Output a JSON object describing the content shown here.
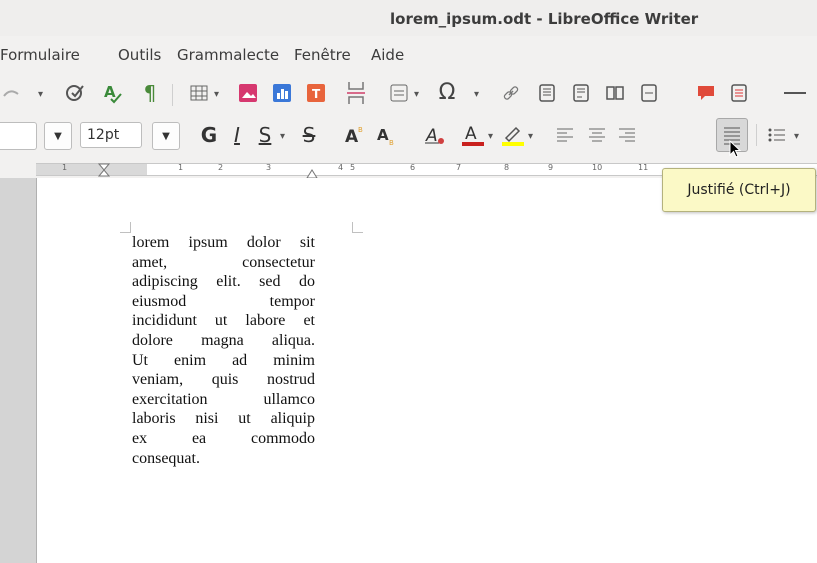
{
  "window": {
    "title": "lorem_ipsum.odt - LibreOffice Writer"
  },
  "menubar": {
    "items": [
      "Formulaire",
      "Outils",
      "Grammalecte",
      "Fenêtre",
      "Aide"
    ]
  },
  "toolbar_standard": {
    "icons": [
      "redo-icon",
      "spellcheck-icon",
      "autospell-icon",
      "formatting-marks-icon",
      "table-icon",
      "image-icon",
      "chart-icon",
      "textbox-icon",
      "page-break-icon",
      "field-icon",
      "special-char-icon",
      "hyperlink-icon",
      "footnote-icon",
      "endnote-icon",
      "bookmark-icon",
      "cross-reference-icon",
      "comment-icon",
      "track-changes-icon",
      "line-icon"
    ],
    "special_char_glyph": "Ω"
  },
  "toolbar_formatting": {
    "font_size": "12pt",
    "bold_glyph": "G",
    "italic_glyph": "I",
    "underline_glyph": "S",
    "strike_glyph": "S",
    "colors": {
      "font_color": "#c9211e",
      "highlight": "#ffff00"
    }
  },
  "ruler": {
    "labels": [
      "1",
      "1",
      "2",
      "3",
      "4",
      "5",
      "6",
      "7",
      "8",
      "9",
      "10",
      "11"
    ]
  },
  "tooltip": {
    "text": "Justifié (Ctrl+J)"
  },
  "document": {
    "lines": [
      "lorem ipsum dolor sit",
      "amet, consectetur",
      "adipiscing elit. sed do",
      "eiusmod tempor",
      "incididunt ut labore et",
      "dolore magna aliqua.",
      "Ut enim ad minim",
      "veniam, quis nostrud",
      "exercitation ullamco",
      "laboris nisi ut aliquip",
      "ex ea commodo",
      "consequat."
    ]
  }
}
